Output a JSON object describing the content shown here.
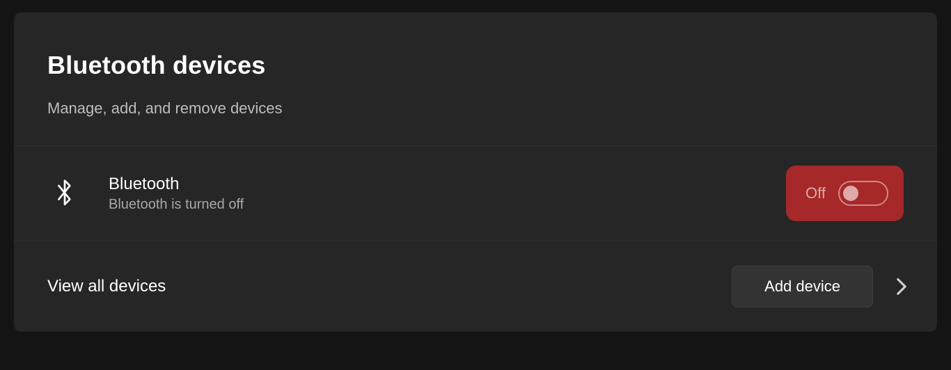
{
  "header": {
    "title": "Bluetooth devices",
    "subtitle": "Manage, add, and remove devices"
  },
  "bluetooth": {
    "label": "Bluetooth",
    "status": "Bluetooth is turned off",
    "toggle_state": "Off"
  },
  "actions": {
    "view_all_label": "View all devices",
    "add_device_label": "Add device"
  }
}
